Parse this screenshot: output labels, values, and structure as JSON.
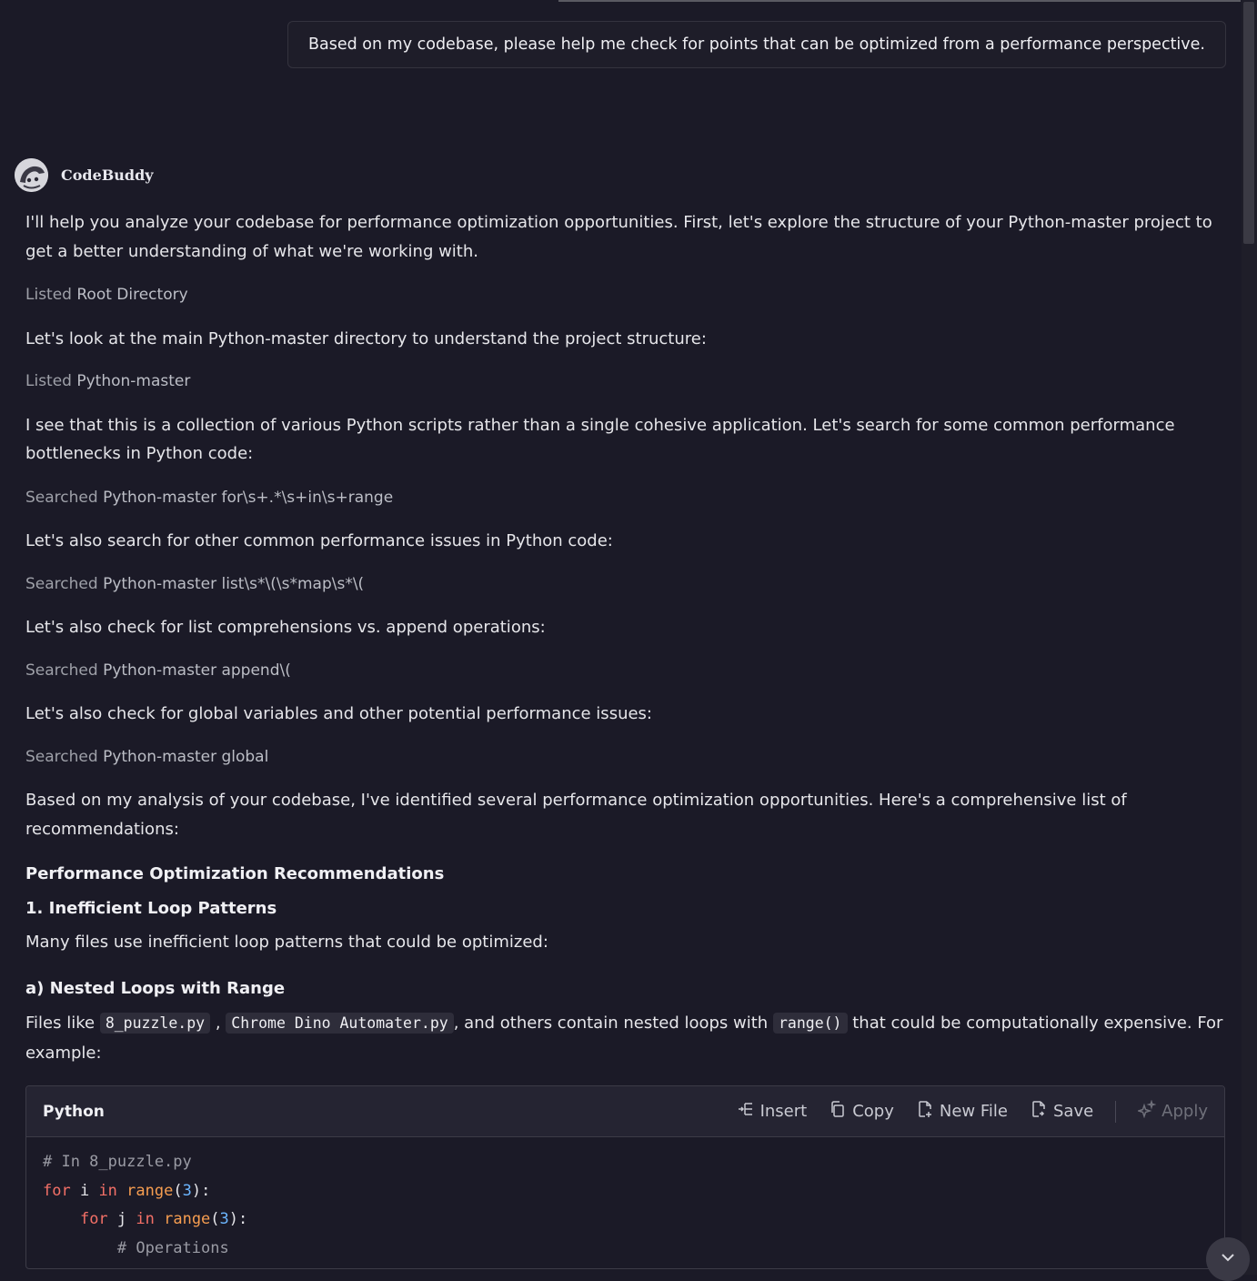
{
  "user_message": "Based on my codebase, please help me check for points that can be optimized from a performance perspective.",
  "assistant": {
    "name": "CodeBuddy"
  },
  "paragraphs": {
    "intro": "I'll help you analyze your codebase for performance optimization opportunities. First, let's explore the structure of your Python-master project to get a better understanding of what we're working with.",
    "look_main": "Let's look at the main Python-master directory to understand the project structure:",
    "collection": "I see that this is a collection of various Python scripts rather than a single cohesive application. Let's search for some common performance bottlenecks in Python code:",
    "search_other": "Let's also search for other common performance issues in Python code:",
    "list_comp": "Let's also check for list comprehensions vs. append operations:",
    "global_vars": "Let's also check for global variables and other potential performance issues:",
    "analysis": "Based on my analysis of your codebase, I've identified several performance optimization opportunities. Here's a comprehensive list of recommendations:",
    "many_files": "Many files use inefficient loop patterns that could be optimized:"
  },
  "tools": {
    "t1": {
      "verb": "Listed",
      "target": "Root Directory"
    },
    "t2": {
      "verb": "Listed",
      "target": "Python-master"
    },
    "t3": {
      "verb": "Searched",
      "target": "Python-master for\\s+.*\\s+in\\s+range"
    },
    "t4": {
      "verb": "Searched",
      "target": "Python-master list\\s*\\(\\s*map\\s*\\("
    },
    "t5": {
      "verb": "Searched",
      "target": "Python-master append\\("
    },
    "t6": {
      "verb": "Searched",
      "target": "Python-master global"
    }
  },
  "headings": {
    "main": "Performance Optimization Recommendations",
    "section1": "1. Inefficient Loop Patterns",
    "sub_a": "a) Nested Loops with Range"
  },
  "files_para": {
    "prefix": "Files like",
    "file1": "8_puzzle.py",
    "comma": ",",
    "file2": "Chrome Dino Automater.py",
    "middle": ", and others contain nested loops with",
    "code": "range()",
    "suffix": "that could be computationally expensive. For example:"
  },
  "code_block": {
    "language": "Python",
    "actions": {
      "insert": "Insert",
      "copy": "Copy",
      "new_file": "New File",
      "save": "Save",
      "apply": "Apply"
    },
    "lines": {
      "l1": "# In 8_puzzle.py",
      "l2": {
        "kw1": "for",
        "var": " i ",
        "kw2": "in",
        "fn": " range",
        "open": "(",
        "num": "3",
        "close": "):"
      },
      "l3": {
        "indent": "    ",
        "kw1": "for",
        "var": " j ",
        "kw2": "in",
        "fn": " range",
        "open": "(",
        "num": "3",
        "close": "):"
      },
      "l4": "        # Operations"
    }
  },
  "colors": {
    "background": "#1b1a27",
    "code_header": "#252432",
    "keyword": "#f47067",
    "function": "#f69d50",
    "number": "#6cb6ff"
  }
}
